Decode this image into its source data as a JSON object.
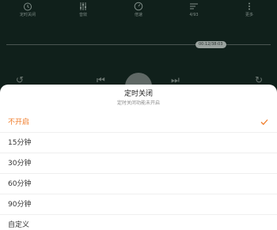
{
  "toolbar": {
    "items": [
      {
        "label": "定时关闭",
        "icon": "timer-icon"
      },
      {
        "label": "音效",
        "icon": "equalizer-icon"
      },
      {
        "label": "倍速",
        "icon": "speed-icon"
      },
      {
        "label": "4/93",
        "icon": "playlist-icon"
      },
      {
        "label": "更多",
        "icon": "more-icon"
      }
    ]
  },
  "player": {
    "progress_time": "00:12/38:03"
  },
  "sheet": {
    "title": "定时关闭",
    "subtitle": "定时关闭功能未开启",
    "options": [
      {
        "label": "不开启",
        "selected": true
      },
      {
        "label": "15分钟",
        "selected": false
      },
      {
        "label": "30分钟",
        "selected": false
      },
      {
        "label": "60分钟",
        "selected": false
      },
      {
        "label": "90分钟",
        "selected": false
      },
      {
        "label": "自定义",
        "selected": false
      }
    ]
  },
  "colors": {
    "accent": "#f07c2a",
    "player_bg": "#10201b",
    "sheet_bg": "#ffffff"
  }
}
